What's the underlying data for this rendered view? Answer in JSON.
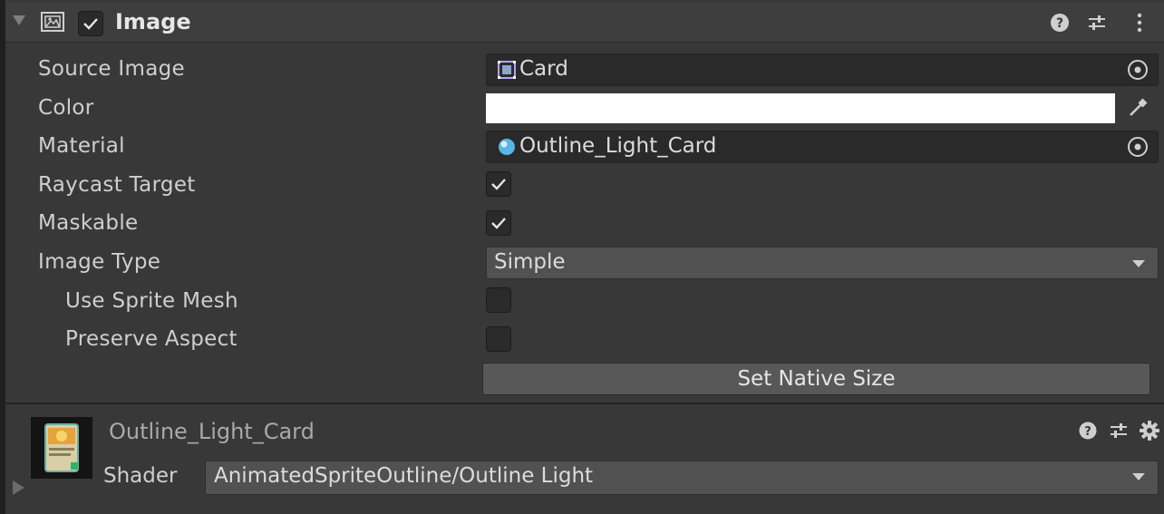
{
  "component": {
    "title": "Image",
    "enabled": true
  },
  "properties": {
    "source_image": {
      "label": "Source Image",
      "value": "Card"
    },
    "color": {
      "label": "Color",
      "value": "#ffffff"
    },
    "material": {
      "label": "Material",
      "value": "Outline_Light_Card"
    },
    "raycast_target": {
      "label": "Raycast Target",
      "checked": true
    },
    "maskable": {
      "label": "Maskable",
      "checked": true
    },
    "image_type": {
      "label": "Image Type",
      "value": "Simple"
    },
    "use_sprite_mesh": {
      "label": "Use Sprite Mesh",
      "checked": false
    },
    "preserve_aspect": {
      "label": "Preserve Aspect",
      "checked": false
    },
    "set_native_size_label": "Set Native Size"
  },
  "material_section": {
    "name": "Outline_Light_Card",
    "shader_label": "Shader",
    "shader_value": "AnimatedSpriteOutline/Outline Light"
  },
  "icons": {
    "header": [
      "image-component-icon",
      "help-icon",
      "presets-icon",
      "more-icon"
    ],
    "fields": [
      "sprite-icon",
      "object-picker-icon",
      "eyedropper-icon",
      "material-sphere-icon"
    ],
    "material": [
      "help-icon",
      "presets-icon",
      "gear-icon"
    ]
  },
  "colors": {
    "panel": "#383838",
    "field": "#2a2a2a",
    "dropdown": "#515151",
    "button": "#585858",
    "accent_sprite": "#b9a1ff",
    "material_sphere": "#5ab4e6"
  }
}
